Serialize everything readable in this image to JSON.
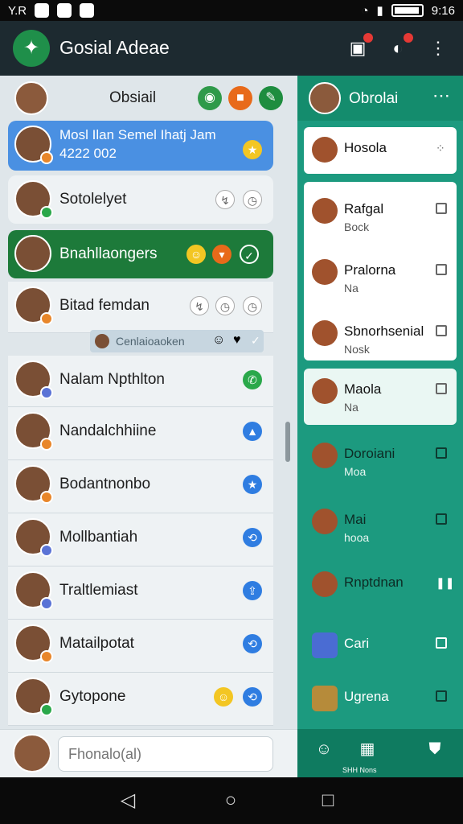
{
  "status": {
    "carrier_label": "Y.R",
    "time": "9:16"
  },
  "app": {
    "title": "Gosial Adeae"
  },
  "left": {
    "header_title": "Obsiail",
    "chats": [
      {
        "name": "Mosl Ilan Semel Ihatj Jam",
        "subtitle": "4222 002",
        "style": "blue"
      },
      {
        "name": "Sotolelyet",
        "style": "plain"
      },
      {
        "name": "Bnahllaongers",
        "style": "green"
      },
      {
        "name": "Bitad femdan",
        "style": "plain"
      },
      {
        "name": "Nalam Npthlton",
        "style": "plain"
      },
      {
        "name": "Nandalchhiine",
        "style": "plain"
      },
      {
        "name": "Bodantnonbo",
        "style": "plain"
      },
      {
        "name": "Mollbantiah",
        "style": "plain"
      },
      {
        "name": "Traltlemiast",
        "style": "plain"
      },
      {
        "name": "Matailpotat",
        "style": "plain"
      },
      {
        "name": "Gytopone",
        "style": "plain"
      }
    ],
    "preview_text": "Cenlaioaoken"
  },
  "compose": {
    "placeholder": "Fhonalo(al)"
  },
  "right": {
    "header_title": "Obrolai",
    "items": [
      {
        "title": "Hosola",
        "subtitle": ""
      },
      {
        "title": "Rafgal",
        "subtitle": "Bock"
      },
      {
        "title": "Pralorna",
        "subtitle": "Na"
      },
      {
        "title": "Sbnorhsenial",
        "subtitle": "Nosk"
      },
      {
        "title": "Maola",
        "subtitle": "Na"
      },
      {
        "title": "Doroiani",
        "subtitle": "Moa"
      },
      {
        "title": "Mai",
        "subtitle": "hooa"
      },
      {
        "title": "Rnptdnan",
        "subtitle": ""
      },
      {
        "title": "Cari",
        "subtitle": ""
      },
      {
        "title": "Ugrena",
        "subtitle": ""
      }
    ],
    "nav_label": "SHH Nons"
  },
  "colors": {
    "app_bar": "#1d2a30",
    "left_panel": "#dfe6ea",
    "right_panel": "#1c9a7f",
    "highlight_blue": "#4a90e2",
    "highlight_green": "#1d7a3a"
  }
}
